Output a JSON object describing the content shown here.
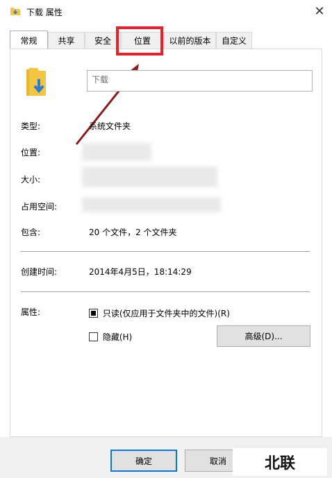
{
  "window": {
    "title": "下载 属性",
    "close_symbol": "✕"
  },
  "tabs": [
    {
      "label": "常规",
      "active": true
    },
    {
      "label": "共享"
    },
    {
      "label": "安全"
    },
    {
      "label": "位置"
    },
    {
      "label": "以前的版本"
    },
    {
      "label": "自定义"
    }
  ],
  "general": {
    "folder_name": "下载",
    "type_label": "类型:",
    "type_value": "系统文件夹",
    "location_label": "位置:",
    "size_label": "大小:",
    "size_on_disk_label": "占用空间:",
    "contains_label": "包含:",
    "contains_value": "20 个文件，2 个文件夹",
    "created_label": "创建时间:",
    "created_value": "2014年4月5日，18:14:29",
    "attributes_label": "属性:",
    "readonly_label": "只读(仅应用于文件夹中的文件)(R)",
    "hidden_label": "隐藏(H)",
    "advanced_button": "高级(D)..."
  },
  "footer": {
    "ok_button": "确定",
    "cancel_button": "取消"
  },
  "watermark": "北联",
  "colors": {
    "highlight": "#e8202a",
    "arrow": "#8b1a1a",
    "folder_yellow": "#f4c542",
    "folder_arrow": "#2b7cd3"
  }
}
